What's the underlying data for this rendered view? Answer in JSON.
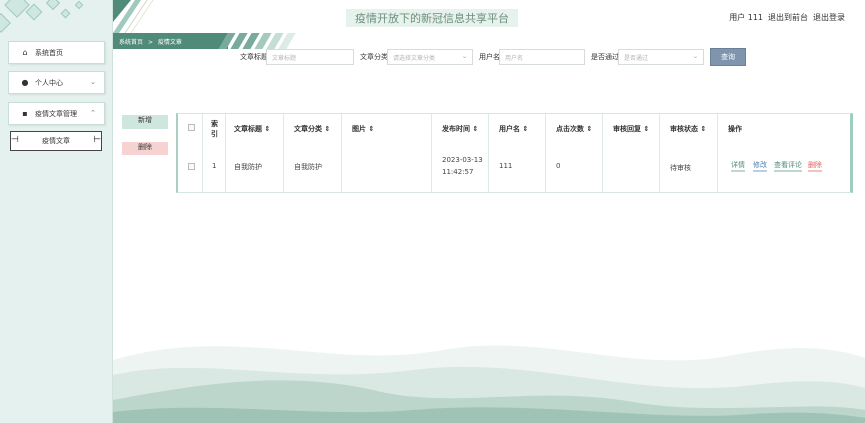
{
  "header": {
    "site_title": "疫情开放下的新冠信息共享平台",
    "user_label": "用户 111",
    "back_to_front": "退出到前台",
    "logout": "退出登录"
  },
  "sidebar": {
    "items": [
      {
        "label": "系统首页",
        "icon": "home-icon"
      },
      {
        "label": "个人中心",
        "icon": "user-icon"
      },
      {
        "label": "疫情文章管理",
        "icon": "grid-icon"
      }
    ],
    "sub_items": [
      {
        "label": "疫情文章"
      }
    ]
  },
  "breadcrumb": {
    "home": "系统首页",
    "separator": ">",
    "current": "疫情文章"
  },
  "search": {
    "title_label": "文章标题",
    "title_placeholder": "文章标题",
    "category_label": "文章分类",
    "category_placeholder": "请选择文章分类",
    "username_label": "用户名",
    "username_placeholder": "用户名",
    "approved_label": "是否通过",
    "approved_placeholder": "是否通过",
    "button": "查询"
  },
  "actions": {
    "add": "新增",
    "delete": "删除"
  },
  "table": {
    "headers": [
      "索引",
      "文章标题",
      "文章分类",
      "图片",
      "发布时间",
      "用户名",
      "点击次数",
      "审核回复",
      "审核状态",
      "操作"
    ],
    "sort_icon": "⇕",
    "rows": [
      {
        "index": "1",
        "title": "自我防护",
        "category": "自我防护",
        "image": "",
        "date": "2023-03-13",
        "time": "11:42:57",
        "username": "111",
        "clicks": "0",
        "reply": "",
        "status": "待审核",
        "ops": [
          "详情",
          "修改",
          "查看评论",
          "删除"
        ]
      }
    ]
  },
  "colors": {
    "accent": "#4f8b78",
    "sidebar_bg": "#e4f1ee",
    "danger": "#e06060",
    "query_button": "#7f95ad"
  }
}
